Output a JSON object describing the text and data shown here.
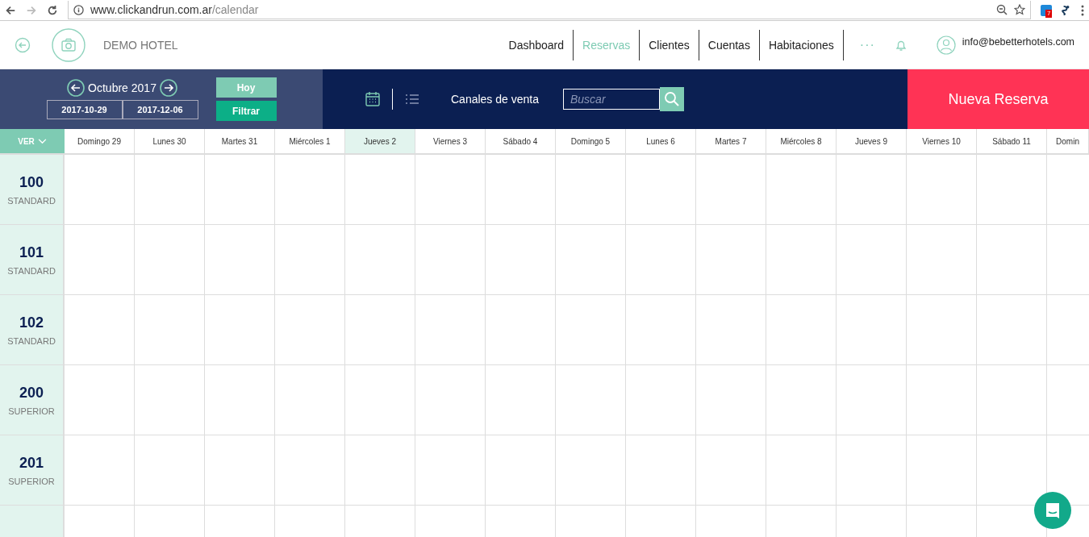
{
  "browser": {
    "url_host": "www.clickandrun.com.ar",
    "url_path": "/calendar",
    "extension_badge": "7"
  },
  "header": {
    "hotel_name": "DEMO HOTEL",
    "nav": [
      {
        "label": "Dashboard",
        "selected": false
      },
      {
        "label": "Reservas",
        "selected": true
      },
      {
        "label": "Clientes",
        "selected": false
      },
      {
        "label": "Cuentas",
        "selected": false
      },
      {
        "label": "Habitaciones",
        "selected": false
      }
    ],
    "more": "···",
    "user_email": "info@bebetterhotels.com"
  },
  "toolbar": {
    "month": "Octubre 2017",
    "date_from": "2017-10-29",
    "date_to": "2017-12-06",
    "today_button": "Hoy",
    "filter_button": "Filtrar",
    "channels_link": "Canales de venta",
    "search": {
      "placeholder": "Buscar"
    },
    "new_button": "Nueva Reserva"
  },
  "calendar": {
    "view_button": "VER",
    "days": [
      {
        "label": "Domingo 29",
        "selected": false
      },
      {
        "label": "Lunes 30",
        "selected": false
      },
      {
        "label": "Martes 31",
        "selected": false
      },
      {
        "label": "Miércoles 1",
        "selected": false
      },
      {
        "label": "Jueves 2",
        "selected": true
      },
      {
        "label": "Viernes 3",
        "selected": false
      },
      {
        "label": "Sábado 4",
        "selected": false
      },
      {
        "label": "Domingo 5",
        "selected": false
      },
      {
        "label": "Lunes 6",
        "selected": false
      },
      {
        "label": "Martes 7",
        "selected": false
      },
      {
        "label": "Miércoles 8",
        "selected": false
      },
      {
        "label": "Jueves 9",
        "selected": false
      },
      {
        "label": "Viernes 10",
        "selected": false
      },
      {
        "label": "Sábado 11",
        "selected": false
      },
      {
        "label": "Domin",
        "selected": false
      }
    ],
    "rooms": [
      {
        "number": "100",
        "type": "STANDARD"
      },
      {
        "number": "101",
        "type": "STANDARD"
      },
      {
        "number": "102",
        "type": "STANDARD"
      },
      {
        "number": "200",
        "type": "SUPERIOR"
      },
      {
        "number": "201",
        "type": "SUPERIOR"
      }
    ]
  }
}
